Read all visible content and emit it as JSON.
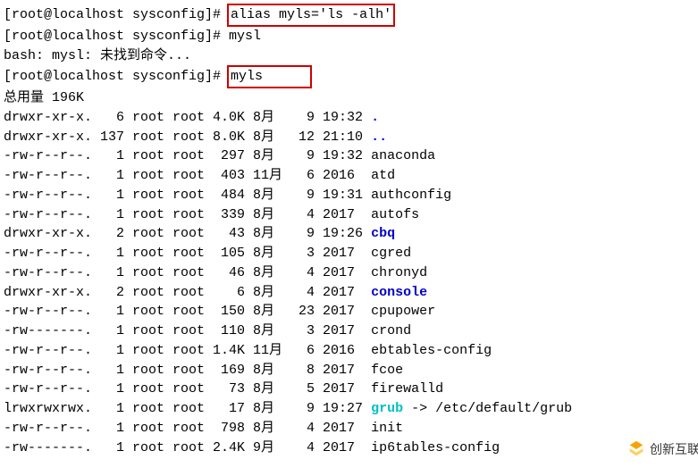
{
  "prompt": "[root@localhost sysconfig]# ",
  "cmd1": "alias myls='ls -alh'",
  "cmd2_typed": "mysl",
  "error_line": "bash: mysl: 未找到命令...",
  "cmd3": "myls",
  "total_line": "总用量 196K",
  "rows": [
    {
      "perm": "drwxr-xr-x.",
      "ln": "  6",
      "own": "root",
      "grp": "root",
      "sz": "4.0K",
      "mon": "8月",
      "day": " 9",
      "time": "19:32",
      "name": ".",
      "cls": "blue",
      "extra": ""
    },
    {
      "perm": "drwxr-xr-x.",
      "ln": "137",
      "own": "root",
      "grp": "root",
      "sz": "8.0K",
      "mon": "8月",
      "day": "12",
      "time": "21:10",
      "name": "..",
      "cls": "blue",
      "extra": ""
    },
    {
      "perm": "-rw-r--r--.",
      "ln": "  1",
      "own": "root",
      "grp": "root",
      "sz": " 297",
      "mon": "8月",
      "day": " 9",
      "time": "19:32",
      "name": "anaconda",
      "cls": "",
      "extra": ""
    },
    {
      "perm": "-rw-r--r--.",
      "ln": "  1",
      "own": "root",
      "grp": "root",
      "sz": " 403",
      "mon": "11月",
      "day": " 6",
      "time": "2016",
      "name": "atd",
      "cls": "",
      "extra": ""
    },
    {
      "perm": "-rw-r--r--.",
      "ln": "  1",
      "own": "root",
      "grp": "root",
      "sz": " 484",
      "mon": "8月",
      "day": " 9",
      "time": "19:31",
      "name": "authconfig",
      "cls": "",
      "extra": ""
    },
    {
      "perm": "-rw-r--r--.",
      "ln": "  1",
      "own": "root",
      "grp": "root",
      "sz": " 339",
      "mon": "8月",
      "day": " 4",
      "time": "2017",
      "name": "autofs",
      "cls": "",
      "extra": ""
    },
    {
      "perm": "drwxr-xr-x.",
      "ln": "  2",
      "own": "root",
      "grp": "root",
      "sz": "  43",
      "mon": "8月",
      "day": " 9",
      "time": "19:26",
      "name": "cbq",
      "cls": "blue",
      "extra": ""
    },
    {
      "perm": "-rw-r--r--.",
      "ln": "  1",
      "own": "root",
      "grp": "root",
      "sz": " 105",
      "mon": "8月",
      "day": " 3",
      "time": "2017",
      "name": "cgred",
      "cls": "",
      "extra": ""
    },
    {
      "perm": "-rw-r--r--.",
      "ln": "  1",
      "own": "root",
      "grp": "root",
      "sz": "  46",
      "mon": "8月",
      "day": " 4",
      "time": "2017",
      "name": "chronyd",
      "cls": "",
      "extra": ""
    },
    {
      "perm": "drwxr-xr-x.",
      "ln": "  2",
      "own": "root",
      "grp": "root",
      "sz": "   6",
      "mon": "8月",
      "day": " 4",
      "time": "2017",
      "name": "console",
      "cls": "blue",
      "extra": ""
    },
    {
      "perm": "-rw-r--r--.",
      "ln": "  1",
      "own": "root",
      "grp": "root",
      "sz": " 150",
      "mon": "8月",
      "day": "23",
      "time": "2017",
      "name": "cpupower",
      "cls": "",
      "extra": ""
    },
    {
      "perm": "-rw-------.",
      "ln": "  1",
      "own": "root",
      "grp": "root",
      "sz": " 110",
      "mon": "8月",
      "day": " 3",
      "time": "2017",
      "name": "crond",
      "cls": "",
      "extra": ""
    },
    {
      "perm": "-rw-r--r--.",
      "ln": "  1",
      "own": "root",
      "grp": "root",
      "sz": "1.4K",
      "mon": "11月",
      "day": " 6",
      "time": "2016",
      "name": "ebtables-config",
      "cls": "",
      "extra": ""
    },
    {
      "perm": "-rw-r--r--.",
      "ln": "  1",
      "own": "root",
      "grp": "root",
      "sz": " 169",
      "mon": "8月",
      "day": " 8",
      "time": "2017",
      "name": "fcoe",
      "cls": "",
      "extra": ""
    },
    {
      "perm": "-rw-r--r--.",
      "ln": "  1",
      "own": "root",
      "grp": "root",
      "sz": "  73",
      "mon": "8月",
      "day": " 5",
      "time": "2017",
      "name": "firewalld",
      "cls": "",
      "extra": ""
    },
    {
      "perm": "lrwxrwxrwx.",
      "ln": "  1",
      "own": "root",
      "grp": "root",
      "sz": "  17",
      "mon": "8月",
      "day": " 9",
      "time": "19:27",
      "name": "grub",
      "cls": "cyan",
      "extra": " -> /etc/default/grub"
    },
    {
      "perm": "-rw-r--r--.",
      "ln": "  1",
      "own": "root",
      "grp": "root",
      "sz": " 798",
      "mon": "8月",
      "day": " 4",
      "time": "2017",
      "name": "init",
      "cls": "",
      "extra": ""
    },
    {
      "perm": "-rw-------.",
      "ln": "  1",
      "own": "root",
      "grp": "root",
      "sz": "2.4K",
      "mon": "9月",
      "day": " 4",
      "time": "2017",
      "name": "ip6tables-config",
      "cls": "",
      "extra": ""
    }
  ],
  "watermark": "创新互联"
}
